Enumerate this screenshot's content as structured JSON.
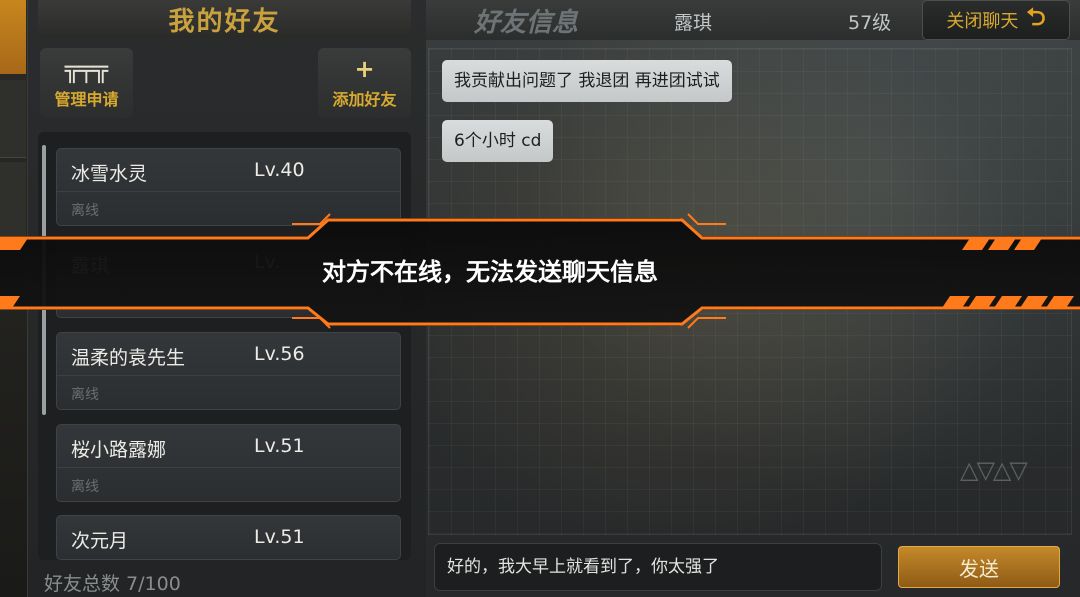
{
  "friends_panel": {
    "title": "我的好友",
    "manage_button": {
      "label": "管理申请",
      "icon": "list-filter-icon"
    },
    "add_button": {
      "label": "添加好友",
      "icon": "plus-icon"
    },
    "friends": [
      {
        "name": "冰雪水灵",
        "level": "Lv.40",
        "status": "离线"
      },
      {
        "name": "露琪",
        "level": "Lv.",
        "status": ""
      },
      {
        "name": "温柔的袁先生",
        "level": "Lv.56",
        "status": "离线"
      },
      {
        "name": "桜小路露娜",
        "level": "Lv.51",
        "status": "离线"
      },
      {
        "name": "次元月",
        "level": "Lv.51",
        "status": ""
      }
    ],
    "total": "好友总数 7/100"
  },
  "chat_panel": {
    "title": "好友信息",
    "friend_name": "露琪",
    "friend_level": "57级",
    "close_button": {
      "label": "关闭聊天",
      "icon": "return-arrow-icon"
    },
    "messages": [
      "我贡献出问题了 我退团 再进团试试",
      "6个小时 cd"
    ],
    "input_value": "好的，我大早上就看到了，你太强了",
    "send_label": "发送"
  },
  "toast": {
    "message": "对方不在线，无法发送聊天信息",
    "accent": "#ff7a1a"
  }
}
